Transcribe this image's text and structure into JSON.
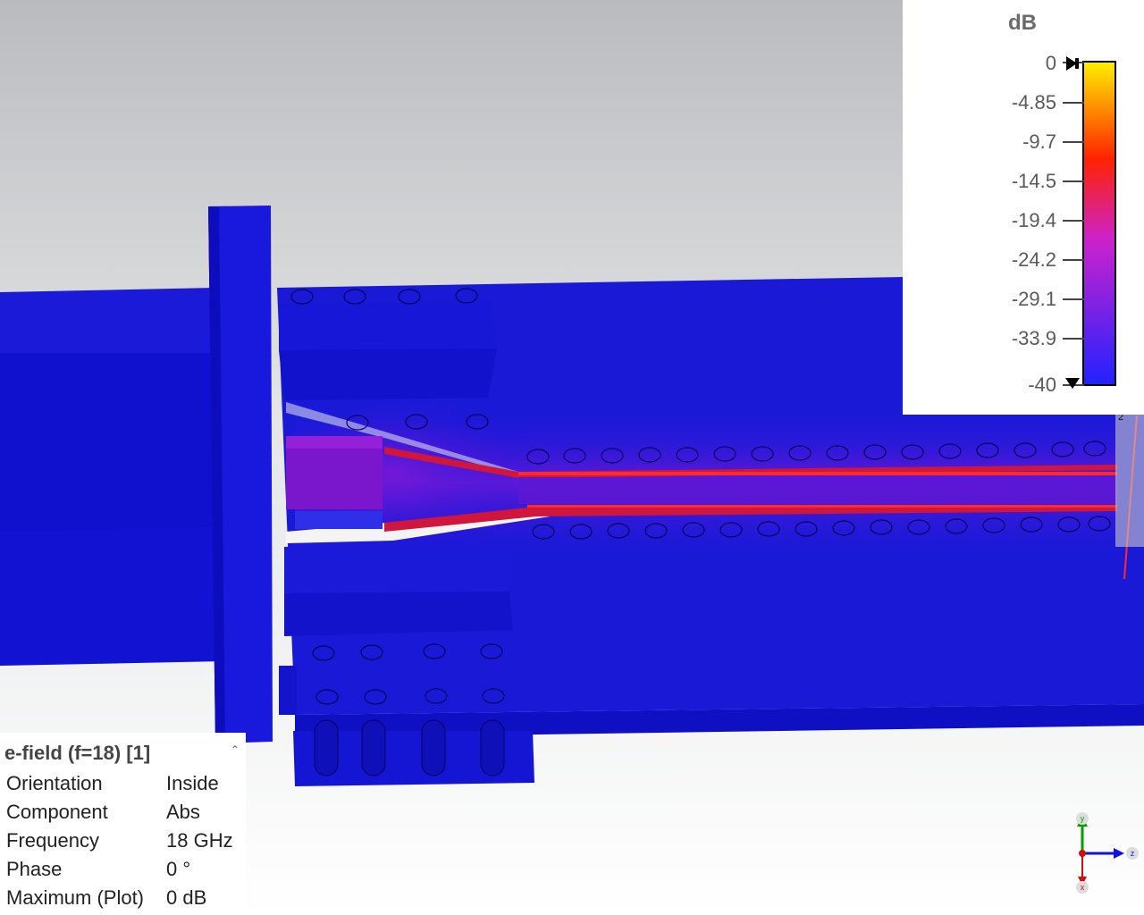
{
  "legend": {
    "unit": "dB",
    "ticks": [
      "0",
      "-4.85",
      "-9.7",
      "-14.5",
      "-19.4",
      "-24.2",
      "-29.1",
      "-33.9",
      "-40"
    ],
    "colors": {
      "max": "#ffee00",
      "high": "#ff2200",
      "mid": "#cc22cc",
      "low": "#2222ff"
    }
  },
  "info_panel": {
    "title": "e-field (f=18) [1]",
    "rows": [
      {
        "key": "Orientation",
        "value": "Inside"
      },
      {
        "key": "Component",
        "value": "Abs"
      },
      {
        "key": "Frequency",
        "value": "18 GHz"
      },
      {
        "key": "Phase",
        "value": "0 °"
      },
      {
        "key": "Maximum (Plot)",
        "value": "0 dB"
      }
    ]
  },
  "axes": {
    "y": "y",
    "z": "z",
    "x": "x"
  },
  "port_label": "2",
  "colors": {
    "model_blue": "#1414d2",
    "background_top": "#b8babd",
    "background_bottom": "#ffffff"
  }
}
